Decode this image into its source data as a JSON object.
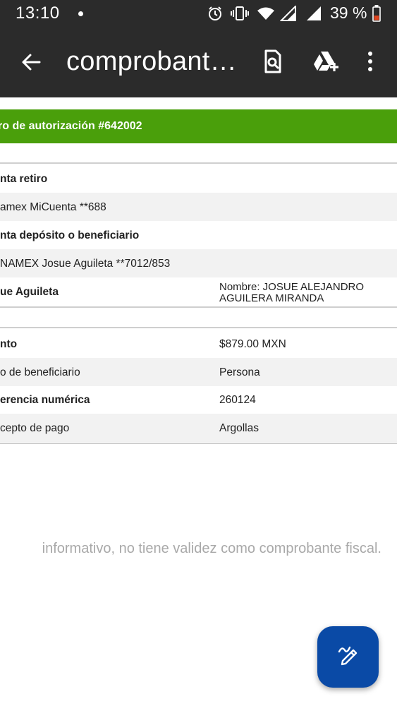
{
  "status_bar": {
    "time": "13:10",
    "battery_percent": "39 %",
    "icons": [
      "notification-dot-icon",
      "alarm-icon",
      "vibrate-icon",
      "wifi-icon",
      "signal-icon",
      "signal-icon",
      "battery-low-icon"
    ]
  },
  "app_bar": {
    "title": "comprobant…",
    "actions": [
      "search-document-icon",
      "drive-add-icon",
      "more-vert-icon"
    ]
  },
  "authorization": {
    "label": "ro de autorización #642002"
  },
  "details": [
    {
      "label": "nta retiro",
      "bold": true,
      "value": ""
    },
    {
      "label": "amex MiCuenta **688",
      "bold": false,
      "value": ""
    },
    {
      "label": "nta depósito o beneficiario",
      "bold": true,
      "value": ""
    },
    {
      "label": "NAMEX Josue Aguileta **7012/853",
      "bold": false,
      "value": ""
    },
    {
      "label": "ue Aguileta",
      "bold": true,
      "value_line1": "Nombre: JOSUE ALEJANDRO",
      "value_line2": "AGUILERA MIRANDA"
    }
  ],
  "payment": [
    {
      "label": "nto",
      "bold": true,
      "value": "$879.00 MXN"
    },
    {
      "label": "o de beneficiario",
      "bold": false,
      "value": "Persona"
    },
    {
      "label": "erencia numérica",
      "bold": true,
      "value": "260124"
    },
    {
      "label": "cepto de pago",
      "bold": false,
      "value": "Argollas"
    }
  ],
  "notice": "informativo, no tiene validez como comprobante fiscal.",
  "fab": {
    "icon": "edit-pen-icon"
  },
  "colors": {
    "bar_bg": "#2b2b2b",
    "accent_green": "#4a9f0b",
    "fab_blue": "#0a4aa6",
    "row_shade": "#f2f2f2"
  }
}
